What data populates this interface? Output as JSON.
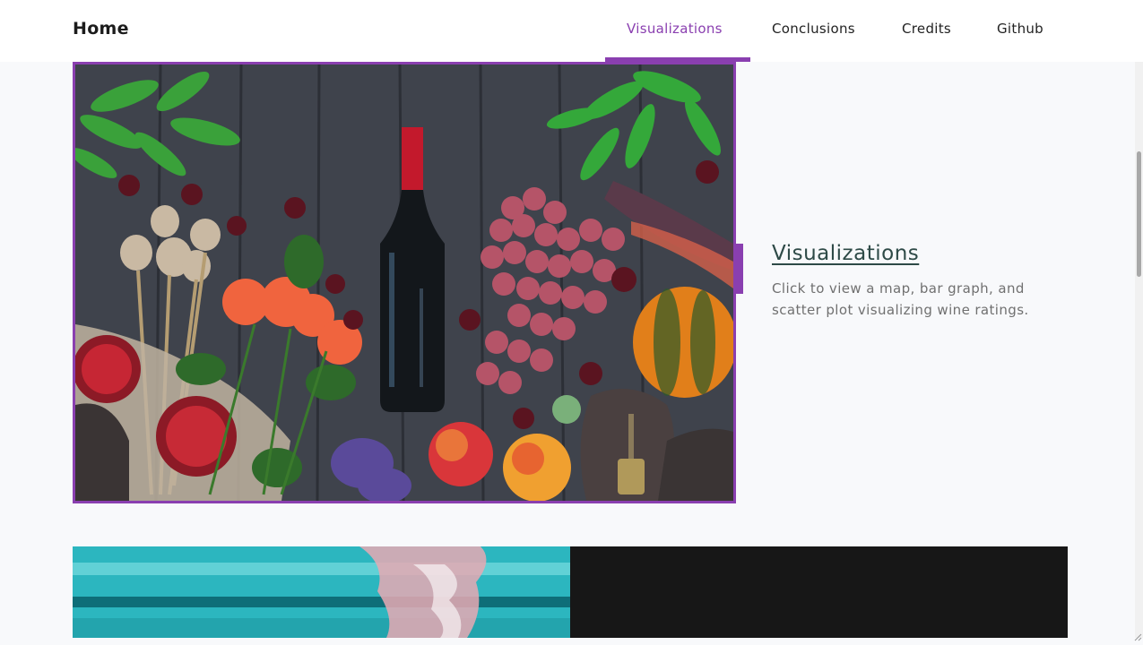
{
  "nav": {
    "brand": "Home",
    "items": [
      {
        "label": "Visualizations",
        "active": true
      },
      {
        "label": "Conclusions",
        "active": false
      },
      {
        "label": "Credits",
        "active": false
      },
      {
        "label": "Github",
        "active": false
      }
    ]
  },
  "feature_card": {
    "title": "Visualizations",
    "description": "Click to view a map, bar graph, and scatter plot visualizing wine ratings."
  },
  "colors": {
    "accent": "#8a3fb0",
    "title": "#2e4a47",
    "dark_panel": "#171717"
  },
  "icons": [
    "resize-grip-icon"
  ]
}
